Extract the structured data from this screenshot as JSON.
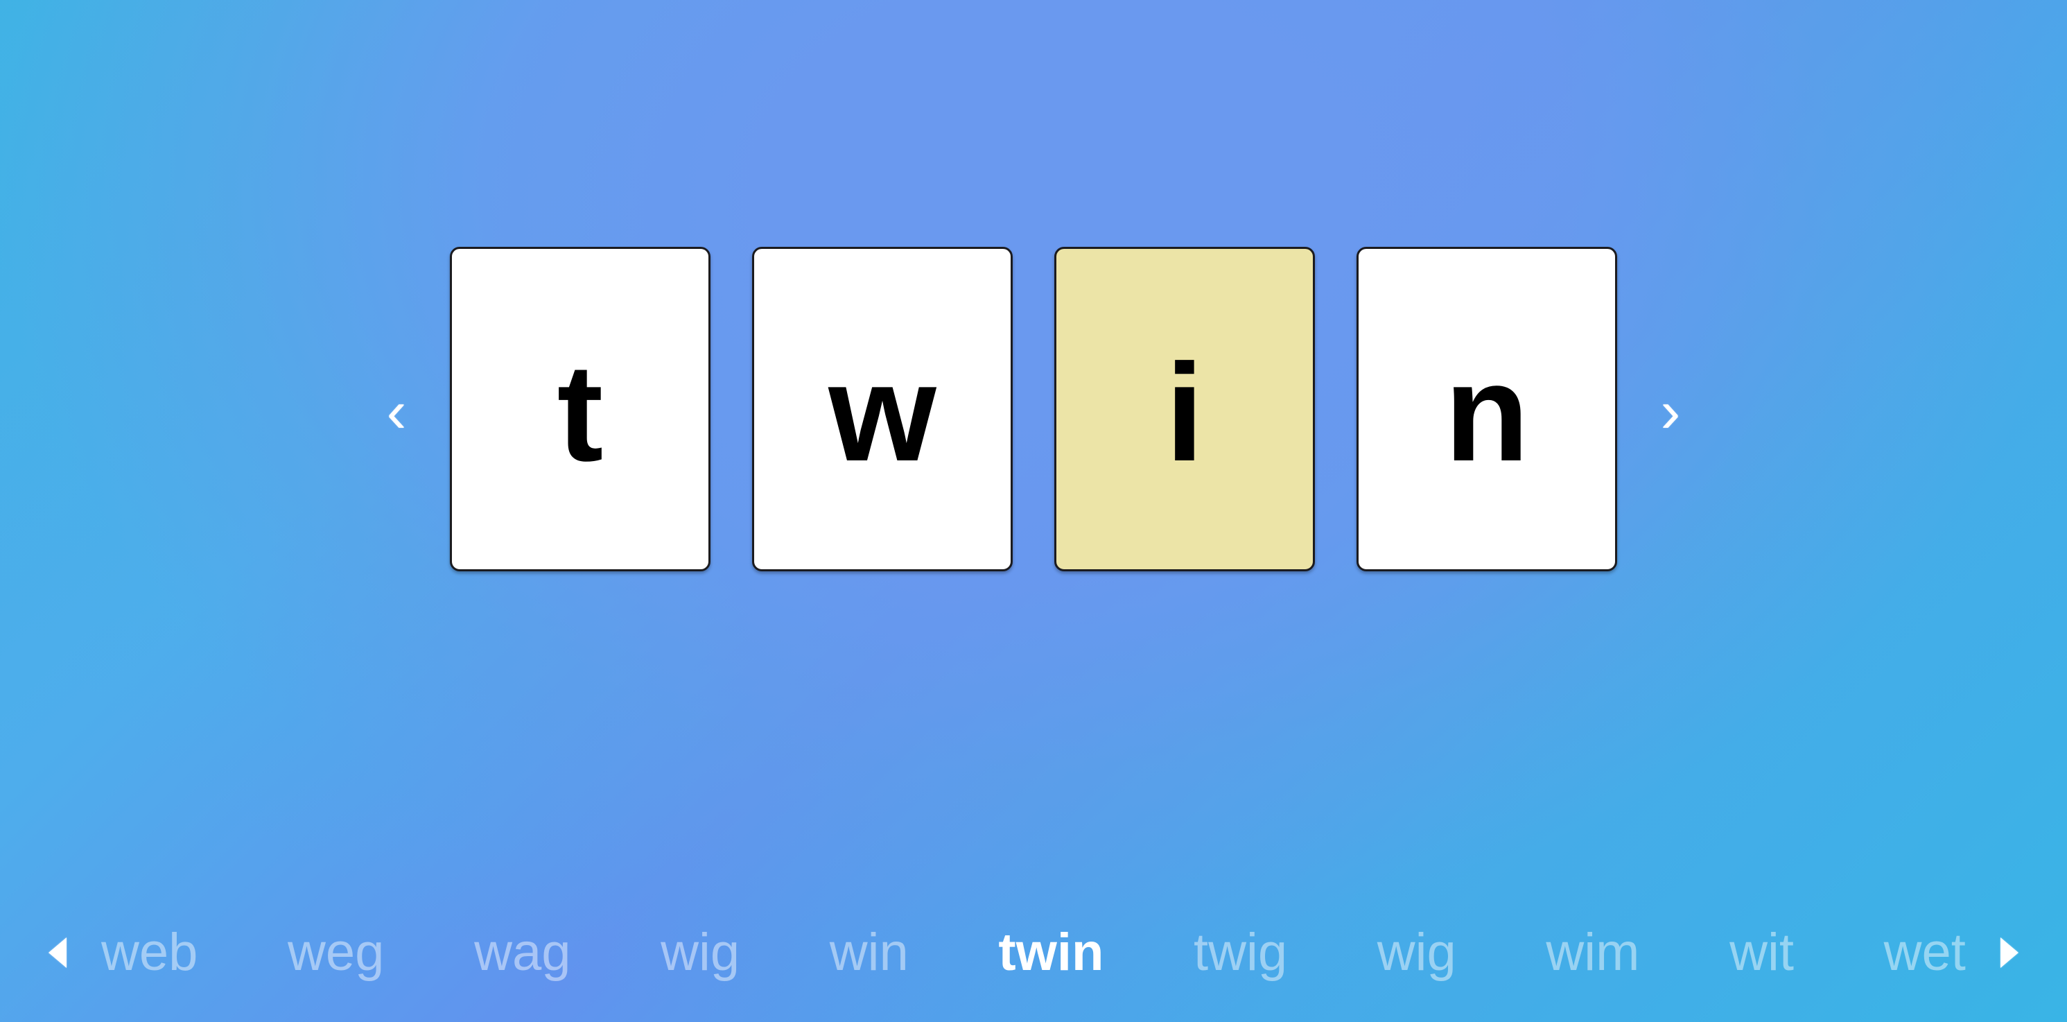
{
  "theme": {
    "background_start": "#40b2e5",
    "background_mid": "#6a99ef",
    "background_end": "#39b4e6",
    "card_bg": "#ffffff",
    "card_selected_bg": "#ece4a7",
    "card_border": "#1b1b1f",
    "letter_color": "#000000",
    "word_inactive_color": "rgba(255,255,255,0.46)",
    "word_active_color": "#ffffff"
  },
  "nav": {
    "prev_chevron": "‹",
    "next_chevron": "›",
    "prev_arrow_name": "previous-word-arrow",
    "next_arrow_name": "next-word-arrow"
  },
  "word_builder": {
    "current_word": "twin",
    "selected_index": 2,
    "cards": [
      {
        "letter": "t",
        "selected": false
      },
      {
        "letter": "w",
        "selected": false
      },
      {
        "letter": "i",
        "selected": true
      },
      {
        "letter": "n",
        "selected": false
      }
    ]
  },
  "word_strip": {
    "active_word": "twin",
    "active_index": 5,
    "words": [
      {
        "text": "web",
        "active": false
      },
      {
        "text": "weg",
        "active": false
      },
      {
        "text": "wag",
        "active": false
      },
      {
        "text": "wig",
        "active": false
      },
      {
        "text": "win",
        "active": false
      },
      {
        "text": "twin",
        "active": true
      },
      {
        "text": "twig",
        "active": false
      },
      {
        "text": "wig",
        "active": false
      },
      {
        "text": "wim",
        "active": false
      },
      {
        "text": "wit",
        "active": false
      },
      {
        "text": "wet",
        "active": false
      }
    ]
  }
}
